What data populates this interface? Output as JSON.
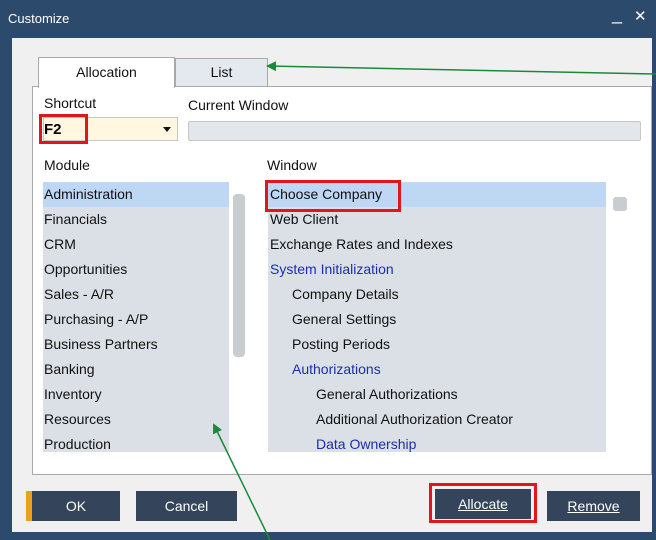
{
  "window": {
    "title": "Customize",
    "minimize_glyph": "_",
    "close_glyph": "✕"
  },
  "tabs": [
    {
      "label": "Allocation",
      "active": true
    },
    {
      "label": "List",
      "active": false
    }
  ],
  "shortcut": {
    "label": "Shortcut",
    "value": "F2"
  },
  "current_window": {
    "label": "Current Window",
    "value": ""
  },
  "module": {
    "header": "Module",
    "items": [
      "Administration",
      "Financials",
      "CRM",
      "Opportunities",
      "Sales - A/R",
      "Purchasing - A/P",
      "Business Partners",
      "Banking",
      "Inventory",
      "Resources",
      "Production"
    ],
    "selected_index": 0
  },
  "window_list": {
    "header": "Window",
    "items": [
      {
        "label": "Choose Company",
        "indent": 0,
        "link": false,
        "selected": true
      },
      {
        "label": "Web Client",
        "indent": 0,
        "link": false,
        "selected": false
      },
      {
        "label": "Exchange Rates and Indexes",
        "indent": 0,
        "link": false,
        "selected": false
      },
      {
        "label": "System Initialization",
        "indent": 0,
        "link": true,
        "selected": false
      },
      {
        "label": "Company Details",
        "indent": 1,
        "link": false,
        "selected": false
      },
      {
        "label": "General Settings",
        "indent": 1,
        "link": false,
        "selected": false
      },
      {
        "label": "Posting Periods",
        "indent": 1,
        "link": false,
        "selected": false
      },
      {
        "label": "Authorizations",
        "indent": 1,
        "link": true,
        "selected": false
      },
      {
        "label": "General Authorizations",
        "indent": 2,
        "link": false,
        "selected": false
      },
      {
        "label": "Additional Authorization Creator",
        "indent": 2,
        "link": false,
        "selected": false
      },
      {
        "label": "Data Ownership",
        "indent": 2,
        "link": true,
        "selected": false
      }
    ]
  },
  "buttons": {
    "ok": "OK",
    "cancel": "Cancel",
    "allocate": "Allocate",
    "remove": "Remove"
  },
  "colors": {
    "title_bar": "#2c4a6b",
    "button_bg": "#34445a",
    "ok_accent": "#e8a21c",
    "highlight_box": "#e0161b",
    "annotation_arrow": "#1a8a3a",
    "selection": "#bdd7f5",
    "link_text": "#1a2fa8"
  }
}
